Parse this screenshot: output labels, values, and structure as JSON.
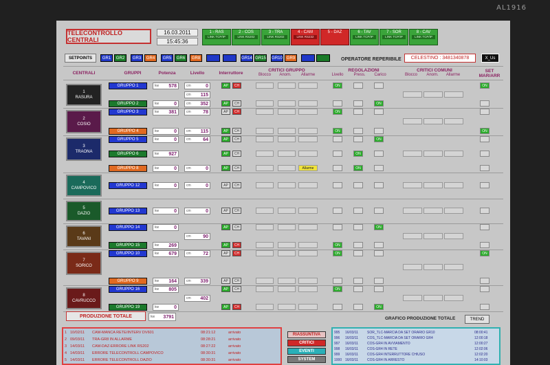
{
  "brand": "AL1916",
  "header": {
    "title": "TELECONTROLLO CENTRALI",
    "date": "16.03.2011",
    "time": "15:45:36"
  },
  "plant_tabs": [
    {
      "label": "1 - RAS",
      "link": "LINK TCP/IP",
      "color": "green"
    },
    {
      "label": "2 - COS",
      "link": "LINK RS202",
      "color": "green"
    },
    {
      "label": "3 - TRA",
      "link": "LINK RS202",
      "color": "green"
    },
    {
      "label": "4 - CAM",
      "link": "LINK RS232",
      "color": "red"
    },
    {
      "label": "5 - DAZ",
      "link": "",
      "color": "red"
    },
    {
      "label": "6 - TAV",
      "link": "LINK TCP/IP",
      "color": "green"
    },
    {
      "label": "7 - SOR",
      "link": "LINK TCP/IP",
      "color": "green"
    },
    {
      "label": "8 - CAV",
      "link": "LINK TCP/IP",
      "color": "green"
    }
  ],
  "setpoints": {
    "label": "SETPOINTS",
    "buttons": [
      {
        "label": "GR1",
        "color": "blue"
      },
      {
        "label": "GR2",
        "color": "green"
      },
      {
        "label": "GR3",
        "color": "blue"
      },
      {
        "label": "GR4",
        "color": "orange"
      },
      {
        "label": "GR5",
        "color": "blue"
      },
      {
        "label": "GR6",
        "color": "green"
      },
      {
        "label": "GR8",
        "color": "orange"
      },
      {
        "label": "",
        "color": "blue"
      },
      {
        "label": "",
        "color": "blue"
      },
      {
        "label": "GR14",
        "color": "blue"
      },
      {
        "label": "GR15",
        "color": "green"
      },
      {
        "label": "GR10",
        "color": "blue"
      },
      {
        "label": "GR9",
        "color": "orange"
      },
      {
        "label": "",
        "color": "blue"
      },
      {
        "label": "",
        "color": "green"
      }
    ]
  },
  "operatore": {
    "label": "OPERATORE REPERIBILE",
    "value": "CELESTINO : 3481340878",
    "user_button": "X_Us"
  },
  "table_headers": {
    "centrali": "CENTRALI",
    "gruppi": "GRUPPI",
    "potenza": "Potenza",
    "livello": "Livello",
    "interruttore": "Interruttore",
    "critici_gruppo": "CRITICI GRUPPO",
    "critici_gruppo_sub": [
      "Blocco",
      "Anom.",
      "Allarme"
    ],
    "regolazioni": "REGOLAZIONI",
    "regolazioni_sub": [
      "Livello",
      "Press.",
      "Carico"
    ],
    "critici_comuni": "CRITICI COMUNI",
    "critici_comuni_sub": [
      "Blocco",
      "Anom.",
      "Allarme"
    ],
    "set": "SET MAR/ARR"
  },
  "plants": [
    {
      "number": "1",
      "name": "RASURA",
      "level": {
        "unit": "cm",
        "value": [
          "0",
          "115",
          "352"
        ]
      },
      "groups": [
        {
          "label": "GRUPPO 1",
          "color": "blue",
          "power_unit": "kw",
          "power": "578",
          "ap": true,
          "ch": true,
          "alarm": "",
          "reg": [
            true,
            false,
            false
          ],
          "set": true
        },
        {
          "label": "GRUPPO 2",
          "color": "green",
          "power_unit": "kw",
          "power": "0",
          "ap": true,
          "ch": false,
          "alarm": "",
          "reg": [
            false,
            false,
            true
          ],
          "set": false
        }
      ]
    },
    {
      "number": "2",
      "name": "COSIO",
      "level": {
        "unit": "cm",
        "value": [
          "78",
          "115"
        ]
      },
      "groups": [
        {
          "label": "GRUPPO 3",
          "color": "blue",
          "power_unit": "kw",
          "power": "381",
          "ap": false,
          "ch": true,
          "alarm": "",
          "reg": [
            true,
            false,
            false
          ],
          "set": false
        },
        {
          "label": "GRUPPO 4",
          "color": "orange",
          "power_unit": "kw",
          "power": "0",
          "ap": true,
          "ch": false,
          "alarm": "",
          "reg": [
            true,
            false,
            false
          ],
          "set": true
        }
      ]
    },
    {
      "number": "3",
      "name": "TRAONA",
      "level": {
        "unit": "cm",
        "value": [
          "64",
          "0"
        ]
      },
      "groups": [
        {
          "label": "GRUPPO 5",
          "color": "blue",
          "power_unit": "kw",
          "power": "0",
          "ap": true,
          "ch": false,
          "alarm": "",
          "reg": [
            false,
            false,
            true
          ],
          "set": false
        },
        {
          "label": "GRUPPO 6",
          "color": "green",
          "power_unit": "kw",
          "power": "927",
          "ap": true,
          "ch": false,
          "alarm": "",
          "reg": [
            false,
            true,
            false
          ],
          "set": false
        },
        {
          "label": "GRUPPO 8",
          "color": "orange",
          "power_unit": "kw",
          "power": "0",
          "ap": true,
          "ch": false,
          "alarm": "Allarme",
          "reg": [
            false,
            true,
            false
          ],
          "set": false
        }
      ]
    },
    {
      "number": "4",
      "name": "CAMPOVICO",
      "level": {
        "unit": "cm",
        "value": [
          "0"
        ]
      },
      "groups": [
        {
          "label": "GRUPPO 12",
          "color": "blue",
          "power_unit": "kw",
          "power": "0",
          "ap": false,
          "ch": false,
          "alarm": "",
          "reg": [
            false,
            false,
            false
          ],
          "set": false
        }
      ]
    },
    {
      "number": "5",
      "name": "DAZIO",
      "level": {
        "unit": "cm",
        "value": [
          "0"
        ]
      },
      "groups": [
        {
          "label": "GRUPPO 13",
          "color": "blue",
          "power_unit": "kw",
          "power": "0",
          "ap": false,
          "ch": false,
          "alarm": "",
          "reg": [
            false,
            false,
            false
          ],
          "set": false
        }
      ]
    },
    {
      "number": "6",
      "name": "TAVANI",
      "level": {
        "unit": "cm",
        "value": [
          "90"
        ]
      },
      "groups": [
        {
          "label": "GRUPPO 14",
          "color": "blue",
          "power_unit": "kw",
          "power": "0",
          "ap": true,
          "ch": false,
          "alarm": "",
          "reg": [
            false,
            false,
            true
          ],
          "set": false
        },
        {
          "label": "GRUPPO 15",
          "color": "green",
          "power_unit": "kw",
          "power": "269",
          "ap": true,
          "ch": true,
          "alarm": "",
          "reg": [
            true,
            false,
            false
          ],
          "set": false
        }
      ]
    },
    {
      "number": "7",
      "name": "SORICO",
      "level": {
        "unit": "cm",
        "value": [
          "72",
          "339"
        ]
      },
      "groups": [
        {
          "label": "GRUPPO 10",
          "color": "blue",
          "power_unit": "kw",
          "power": "679",
          "ap": false,
          "ch": true,
          "alarm": "",
          "reg": [
            true,
            false,
            false
          ],
          "set": true
        },
        {
          "label": "GRUPPO 9",
          "color": "orange",
          "power_unit": "kw",
          "power": "164",
          "ap": false,
          "ch": false,
          "alarm": "",
          "reg": [
            false,
            false,
            false
          ],
          "set": false
        }
      ]
    },
    {
      "number": "8",
      "name": "CAVRUCCO",
      "level": {
        "unit": "cm",
        "value": [
          "402"
        ]
      },
      "groups": [
        {
          "label": "GRUPPO 16",
          "color": "blue",
          "power_unit": "kw",
          "power": "805",
          "ap": true,
          "ch": false,
          "alarm": "",
          "reg": [
            true,
            false,
            false
          ],
          "set": false
        },
        {
          "label": "GRUPPO 19",
          "color": "green",
          "power_unit": "kw",
          "power": "0",
          "ap": true,
          "ch": true,
          "alarm": "",
          "reg": [
            false,
            false,
            true
          ],
          "set": false
        }
      ]
    }
  ],
  "totals": {
    "label": "PRODUZIONE TOTALE",
    "unit": "kw",
    "value": "3791",
    "graph_label": "GRAFICO PRODUZIONE TOTALE",
    "trend_button": "TREND"
  },
  "alarms": [
    {
      "n": "1",
      "date": "10/02/11",
      "text": "CAM-MANCA RETE/INTERV DV601",
      "time": "08:21:12",
      "state": "arrivato"
    },
    {
      "n": "2",
      "date": "09/03/11",
      "text": "TRA-GR8 IN ALLARME",
      "time": "08:28:21",
      "state": "arrivato"
    },
    {
      "n": "3",
      "date": "14/03/11",
      "text": "CAM-DAZ-ERRORE LINK RS202",
      "time": "08:27:22",
      "state": "arrivato"
    },
    {
      "n": "4",
      "date": "14/03/11",
      "text": "ERRORE TELECONTROLL CAMPOVICO",
      "time": "08:30:31",
      "state": "arrivato"
    },
    {
      "n": "5",
      "date": "14/03/11",
      "text": "ERRORE TELECONTROLL DAZIO",
      "time": "08:30:31",
      "state": "arrivato"
    }
  ],
  "mode_buttons": [
    {
      "label": "RIASSUNTIVA",
      "color": "#e7c3c3",
      "text": "#c02020"
    },
    {
      "label": "CRITICI",
      "color": "#d02828",
      "text": "#ffffff"
    },
    {
      "label": "EVENTI",
      "color": "#2ab0b8",
      "text": "#ffffff"
    },
    {
      "label": "SYSTEM",
      "color": "#7a7a7a",
      "text": "#ffffff"
    }
  ],
  "log": [
    {
      "n": "995",
      "date": "16/03/11",
      "text": "SOR_TLC-MARCIA DA SET ORARIO GR10",
      "time": "08:00:41"
    },
    {
      "n": "996",
      "date": "16/03/11",
      "text": "COS_TLC-MARCIA DA SET ORARIO GR4",
      "time": "12:00:18"
    },
    {
      "n": "997",
      "date": "16/03/11",
      "text": "COS-GR4 IN AVVIAMENTO",
      "time": "12:00:27"
    },
    {
      "n": "998",
      "date": "16/03/11",
      "text": "COS-GR4 IN RETE",
      "time": "12:02:06"
    },
    {
      "n": "999",
      "date": "16/03/11",
      "text": "COS-GR4 INTERRUTTORE CHIUSO",
      "time": "12:02:20"
    },
    {
      "n": "1000",
      "date": "16/03/11",
      "text": "COS-GR4 IN ARRESTO",
      "time": "14:10:03"
    }
  ]
}
